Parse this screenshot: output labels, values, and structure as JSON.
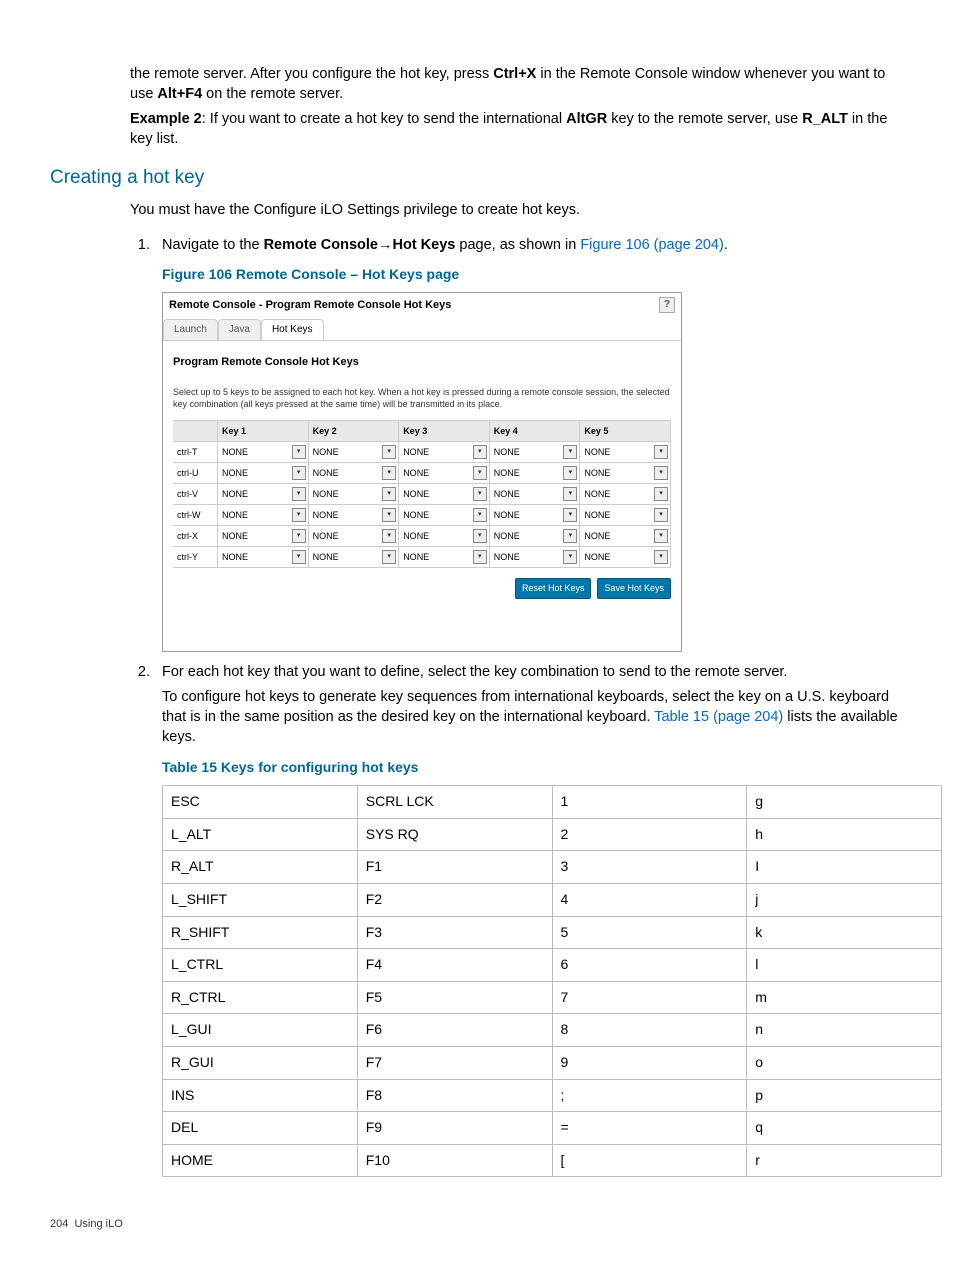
{
  "intro": {
    "p1a": "the remote server. After you configure the hot key, press ",
    "p1b": "Ctrl+X",
    "p1c": " in the Remote Console window whenever you want to use ",
    "p1d": "Alt+F4",
    "p1e": " on the remote server.",
    "p2a": "Example 2",
    "p2b": ": If you want to create a hot key to send the international ",
    "p2c": "AltGR",
    "p2d": " key to the remote server, use ",
    "p2e": "R_ALT",
    "p2f": " in the key list."
  },
  "heading": "Creating a hot key",
  "priv": "You must have the Configure iLO Settings privilege to create hot keys.",
  "step1": {
    "a": "Navigate to the ",
    "b": "Remote Console",
    "arrow": "→",
    "c": "Hot Keys",
    "d": " page, as shown in ",
    "link": "Figure 106 (page 204)",
    "e": "."
  },
  "figcap": "Figure 106 Remote Console – Hot Keys page",
  "panel": {
    "title": "Remote Console - Program Remote Console Hot Keys",
    "help": "?",
    "tabs": [
      "Launch",
      "Java",
      "Hot Keys"
    ],
    "subtitle": "Program Remote Console Hot Keys",
    "desc": "Select up to 5 keys to be assigned to each hot key. When a hot key is pressed during a remote console session, the selected key combination (all keys pressed at the same time) will be transmitted in its place.",
    "cols": [
      "",
      "Key 1",
      "Key 2",
      "Key 3",
      "Key 4",
      "Key 5"
    ],
    "rows": [
      "ctrl-T",
      "ctrl-U",
      "ctrl-V",
      "ctrl-W",
      "ctrl-X",
      "ctrl-Y"
    ],
    "cell": "NONE",
    "btn_reset": "Reset Hot Keys",
    "btn_save": "Save Hot Keys"
  },
  "step2": {
    "p1": "For each hot key that you want to define, select the key combination to send to the remote server.",
    "p2a": "To configure hot keys to generate key sequences from international keyboards, select the key on a U.S. keyboard that is in the same position as the desired key on the international keyboard. ",
    "p2link": "Table 15 (page 204)",
    "p2b": " lists the available keys."
  },
  "tablecap": "Table 15 Keys for configuring hot keys",
  "keytable": [
    [
      "ESC",
      "SCRL LCK",
      "1",
      "g"
    ],
    [
      "L_ALT",
      "SYS RQ",
      "2",
      "h"
    ],
    [
      "R_ALT",
      "F1",
      "3",
      "I"
    ],
    [
      "L_SHIFT",
      "F2",
      "4",
      "j"
    ],
    [
      "R_SHIFT",
      "F3",
      "5",
      "k"
    ],
    [
      "L_CTRL",
      "F4",
      "6",
      "l"
    ],
    [
      "R_CTRL",
      "F5",
      "7",
      "m"
    ],
    [
      "L_GUI",
      "F6",
      "8",
      "n"
    ],
    [
      "R_GUI",
      "F7",
      "9",
      "o"
    ],
    [
      "INS",
      "F8",
      ";",
      "p"
    ],
    [
      "DEL",
      "F9",
      "=",
      "q"
    ],
    [
      "HOME",
      "F10",
      "[",
      "r"
    ]
  ],
  "footer_page": "204",
  "footer_text": "Using iLO"
}
